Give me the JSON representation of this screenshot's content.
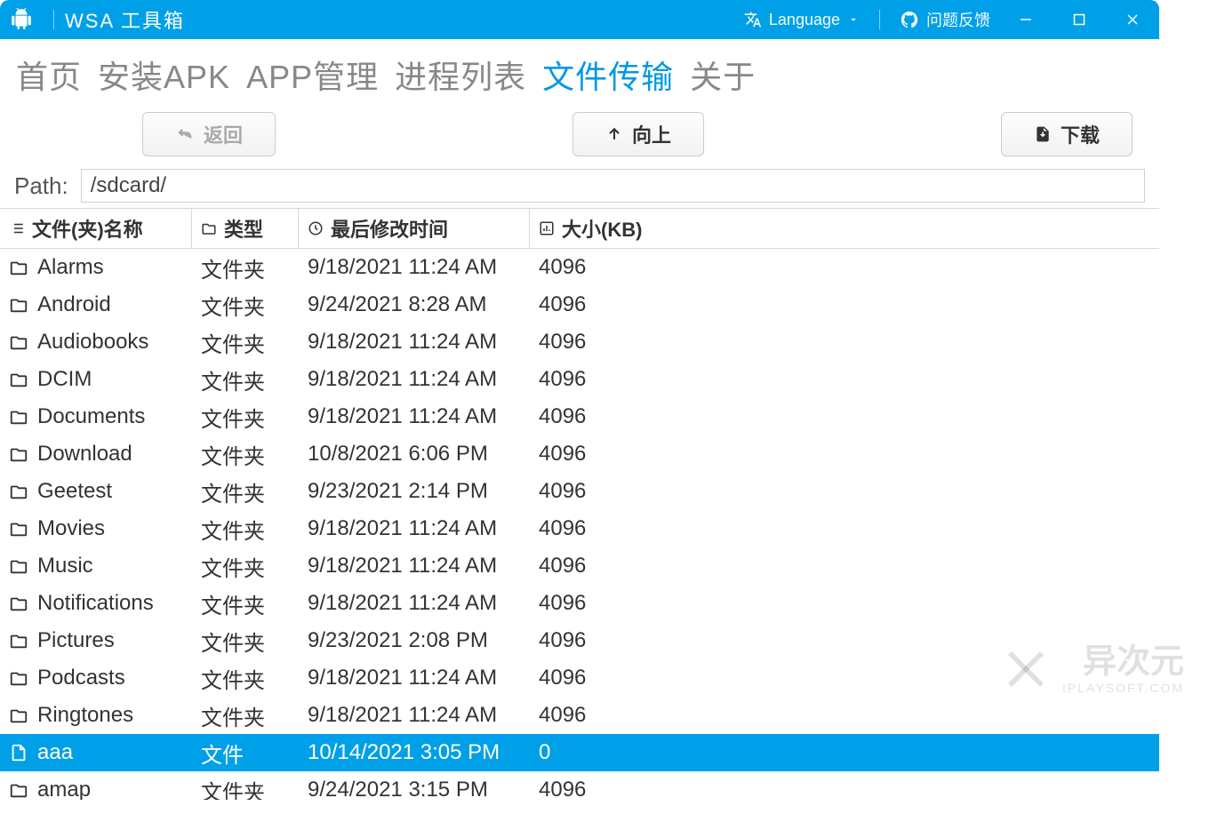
{
  "titlebar": {
    "app_title": "WSA 工具箱",
    "language_label": "Language",
    "feedback_label": "问题反馈"
  },
  "nav": {
    "tabs": [
      "首页",
      "安装APK",
      "APP管理",
      "进程列表",
      "文件传输",
      "关于"
    ],
    "active_index": 4
  },
  "toolbar": {
    "back_label": "返回",
    "up_label": "向上",
    "download_label": "下载"
  },
  "path": {
    "label": "Path:",
    "value": "/sdcard/"
  },
  "columns": {
    "name": "文件(夹)名称",
    "type": "类型",
    "modified": "最后修改时间",
    "size": "大小(KB)"
  },
  "files": [
    {
      "name": "Alarms",
      "type": "文件夹",
      "modified": "9/18/2021 11:24 AM",
      "size": "4096",
      "kind": "folder",
      "selected": false
    },
    {
      "name": "Android",
      "type": "文件夹",
      "modified": "9/24/2021 8:28 AM",
      "size": "4096",
      "kind": "folder",
      "selected": false
    },
    {
      "name": "Audiobooks",
      "type": "文件夹",
      "modified": "9/18/2021 11:24 AM",
      "size": "4096",
      "kind": "folder",
      "selected": false
    },
    {
      "name": "DCIM",
      "type": "文件夹",
      "modified": "9/18/2021 11:24 AM",
      "size": "4096",
      "kind": "folder",
      "selected": false
    },
    {
      "name": "Documents",
      "type": "文件夹",
      "modified": "9/18/2021 11:24 AM",
      "size": "4096",
      "kind": "folder",
      "selected": false
    },
    {
      "name": "Download",
      "type": "文件夹",
      "modified": "10/8/2021 6:06 PM",
      "size": "4096",
      "kind": "folder",
      "selected": false
    },
    {
      "name": "Geetest",
      "type": "文件夹",
      "modified": "9/23/2021 2:14 PM",
      "size": "4096",
      "kind": "folder",
      "selected": false
    },
    {
      "name": "Movies",
      "type": "文件夹",
      "modified": "9/18/2021 11:24 AM",
      "size": "4096",
      "kind": "folder",
      "selected": false
    },
    {
      "name": "Music",
      "type": "文件夹",
      "modified": "9/18/2021 11:24 AM",
      "size": "4096",
      "kind": "folder",
      "selected": false
    },
    {
      "name": "Notifications",
      "type": "文件夹",
      "modified": "9/18/2021 11:24 AM",
      "size": "4096",
      "kind": "folder",
      "selected": false
    },
    {
      "name": "Pictures",
      "type": "文件夹",
      "modified": "9/23/2021 2:08 PM",
      "size": "4096",
      "kind": "folder",
      "selected": false
    },
    {
      "name": "Podcasts",
      "type": "文件夹",
      "modified": "9/18/2021 11:24 AM",
      "size": "4096",
      "kind": "folder",
      "selected": false
    },
    {
      "name": "Ringtones",
      "type": "文件夹",
      "modified": "9/18/2021 11:24 AM",
      "size": "4096",
      "kind": "folder",
      "selected": false
    },
    {
      "name": "aaa",
      "type": "文件",
      "modified": "10/14/2021 3:05 PM",
      "size": "0",
      "kind": "file",
      "selected": true
    },
    {
      "name": "amap",
      "type": "文件夹",
      "modified": "9/24/2021 3:15 PM",
      "size": "4096",
      "kind": "folder",
      "selected": false
    }
  ],
  "watermark": {
    "text": "异次元",
    "sub": "IPLAYSOFT.COM"
  }
}
